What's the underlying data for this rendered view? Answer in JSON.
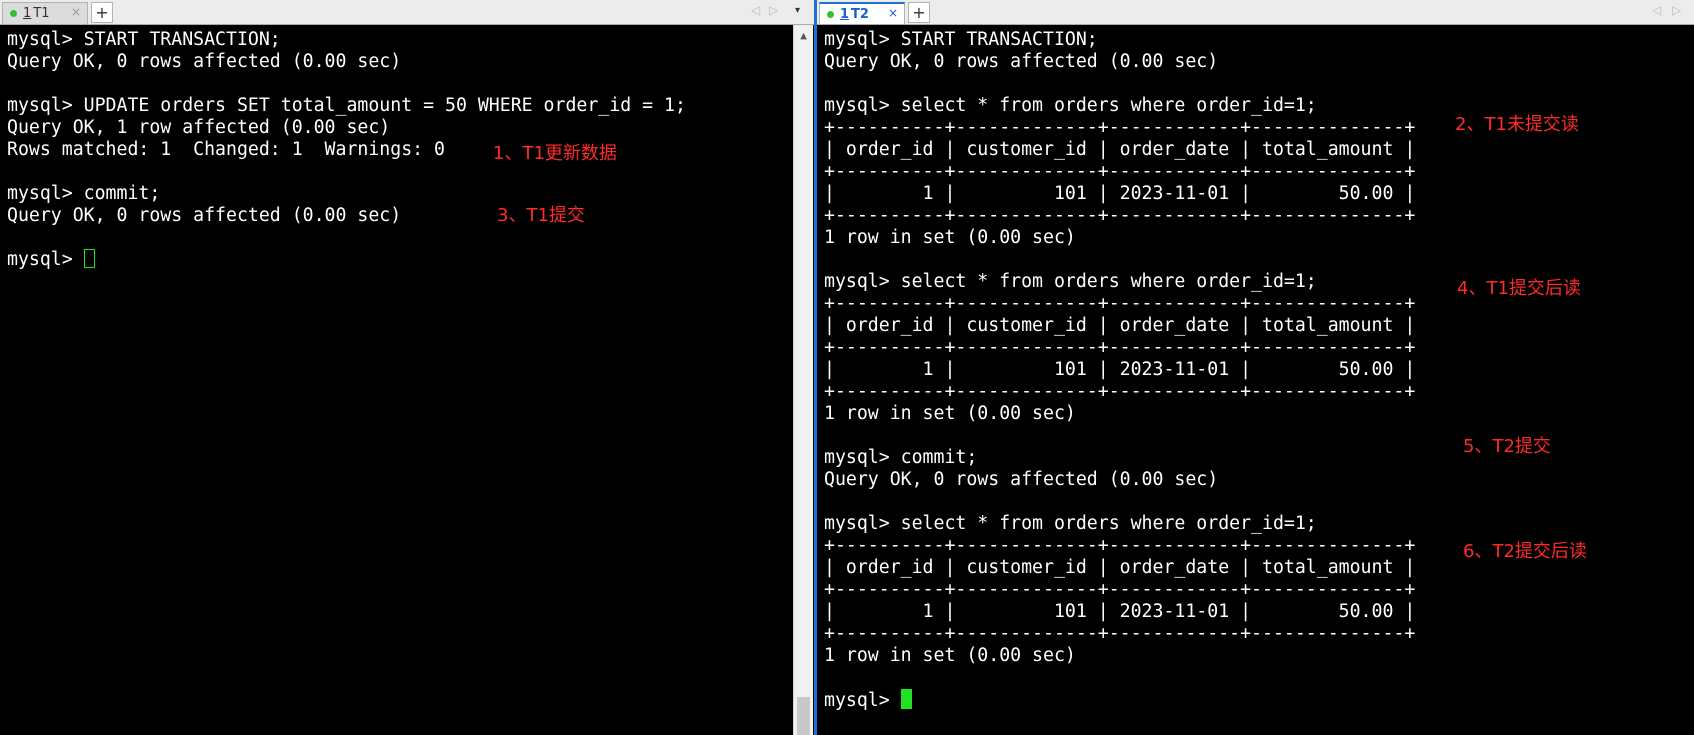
{
  "tabs": {
    "left": {
      "number": "1",
      "title": "T1",
      "close": "×",
      "add": "+",
      "prev": "◁",
      "next": "▷",
      "menu": "▾"
    },
    "right": {
      "number": "1",
      "title": "T2",
      "close": "×",
      "add": "+",
      "prev": "◁",
      "next": "▷"
    }
  },
  "session1": {
    "lines": [
      "mysql> START TRANSACTION;",
      "Query OK, 0 rows affected (0.00 sec)",
      "",
      "mysql> UPDATE orders SET total_amount = 50 WHERE order_id = 1;",
      "Query OK, 1 row affected (0.00 sec)",
      "Rows matched: 1  Changed: 1  Warnings: 0",
      "",
      "mysql> commit;",
      "Query OK, 0 rows affected (0.00 sec)",
      ""
    ],
    "prompt": "mysql> ",
    "annotations": [
      "1、T1更新数据",
      "3、T1提交"
    ]
  },
  "session2": {
    "lines": [
      "mysql> START TRANSACTION;",
      "Query OK, 0 rows affected (0.00 sec)",
      "",
      "mysql> select * from orders where order_id=1;",
      "+----------+-------------+------------+--------------+",
      "| order_id | customer_id | order_date | total_amount |",
      "+----------+-------------+------------+--------------+",
      "|        1 |         101 | 2023-11-01 |        50.00 |",
      "+----------+-------------+------------+--------------+",
      "1 row in set (0.00 sec)",
      "",
      "mysql> select * from orders where order_id=1;",
      "+----------+-------------+------------+--------------+",
      "| order_id | customer_id | order_date | total_amount |",
      "+----------+-------------+------------+--------------+",
      "|        1 |         101 | 2023-11-01 |        50.00 |",
      "+----------+-------------+------------+--------------+",
      "1 row in set (0.00 sec)",
      "",
      "mysql> commit;",
      "Query OK, 0 rows affected (0.00 sec)",
      "",
      "mysql> select * from orders where order_id=1;",
      "+----------+-------------+------------+--------------+",
      "| order_id | customer_id | order_date | total_amount |",
      "+----------+-------------+------------+--------------+",
      "|        1 |         101 | 2023-11-01 |        50.00 |",
      "+----------+-------------+------------+--------------+",
      "1 row in set (0.00 sec)",
      ""
    ],
    "prompt": "mysql> ",
    "annotations": [
      "2、T1未提交读",
      "4、T1提交后读",
      "5、T2提交",
      "6、T2提交后读"
    ]
  },
  "colors": {
    "annotation": "#ff2a2a",
    "cursor": "#22e022",
    "active_tab": "#1a5fd1",
    "splitter": "#1e6fd6"
  },
  "scrollbar": {
    "up": "▲"
  }
}
